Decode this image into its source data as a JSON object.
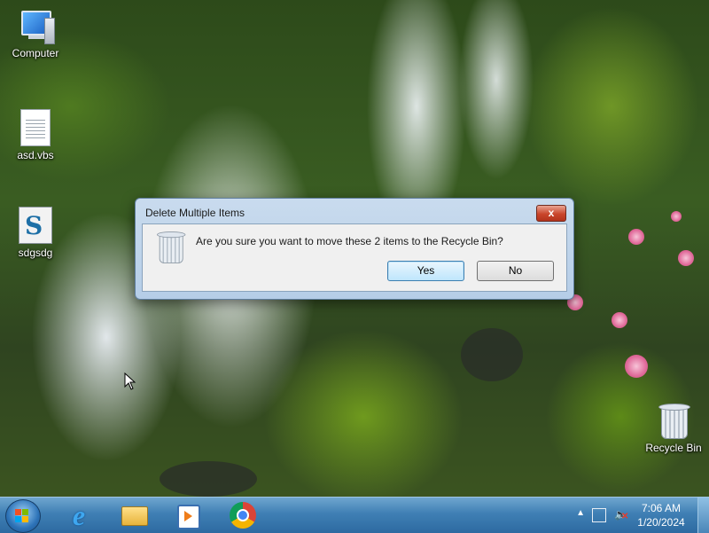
{
  "desktop": {
    "icons": [
      {
        "label": "Computer",
        "icon": "computer-icon"
      },
      {
        "label": "asd.vbs",
        "icon": "vbs-file-icon"
      },
      {
        "label": "sdgsdg",
        "icon": "script-file-icon"
      },
      {
        "label": "Recycle Bin",
        "icon": "recycle-bin-icon"
      }
    ]
  },
  "dialog": {
    "title": "Delete Multiple Items",
    "close_label": "x",
    "message": "Are you sure you want to move these 2 items to the Recycle Bin?",
    "yes_label": "Yes",
    "no_label": "No"
  },
  "taskbar": {
    "pinned": [
      "internet-explorer-icon",
      "file-explorer-icon",
      "media-player-icon",
      "chrome-icon"
    ],
    "clock": {
      "time": "7:06 AM",
      "date": "1/20/2024"
    },
    "tray_arrow": "▲"
  },
  "colors": {
    "taskbar": "#3f7fb4",
    "dialog_frame": "#c9dbee",
    "close_button": "#c9452b"
  }
}
